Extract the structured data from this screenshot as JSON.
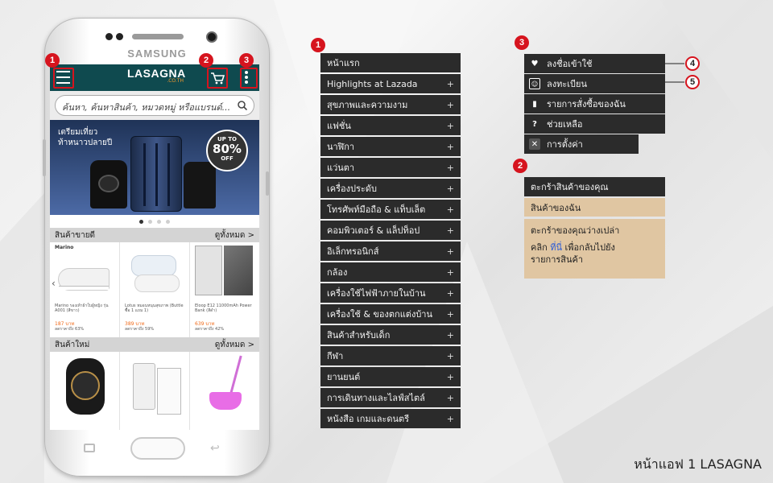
{
  "phone": {
    "brand": "SAMSUNG",
    "app_logo": "LASAGNA",
    "app_logo_sub": ".CO.TH",
    "search_placeholder": "ค้นหา, ค้นหาสินค้า, หมวดหมู่ หรือแบรนด์...",
    "banner": {
      "line1": "เตรียมเที่ยว",
      "line2": "ท้าหนาวปลายปี",
      "badge_top": "UP TO",
      "badge_value": "80%",
      "badge_bottom": "OFF"
    },
    "best_sellers": {
      "title": "สินค้าขายดี",
      "see_all": "ดูทั้งหมด >",
      "products": [
        {
          "brand": "Marino",
          "name": "Marino รองเท้าผ้าใบผู้หญิง รุ่น A001 (สีขาว)",
          "price": "187 บาท",
          "old": "ลดราคาถึง 63%"
        },
        {
          "brand": "Lotus",
          "name": "Lotus หมอนหนุนสุขภาพ (Buttle ซื้อ 1 แถม 1)",
          "price": "389 บาท",
          "old": "ลดราคาถึง 59%"
        },
        {
          "brand": "Eloop",
          "name": "Eloop E12 11000mAh Power Bank (สีดำ)",
          "price": "639 บาท",
          "old": "ลดราคาถึง 42%"
        }
      ]
    },
    "new_items": {
      "title": "สินค้าใหม่",
      "see_all": "ดูทั้งหมด >"
    }
  },
  "markers": [
    "1",
    "2",
    "3",
    "4",
    "5"
  ],
  "menu": {
    "items": [
      {
        "label": "หน้าแรก",
        "expandable": false
      },
      {
        "label": "Highlights at Lazada",
        "expandable": true
      },
      {
        "label": "สุขภาพและความงาม",
        "expandable": true
      },
      {
        "label": "แฟชั่น",
        "expandable": true
      },
      {
        "label": "นาฬิกา",
        "expandable": true
      },
      {
        "label": "แว่นตา",
        "expandable": true
      },
      {
        "label": "เครื่องประดับ",
        "expandable": true
      },
      {
        "label": "โทรศัพท์มือถือ & แท็บเล็ต",
        "expandable": true
      },
      {
        "label": "คอมพิวเตอร์ & แล็ปท็อป",
        "expandable": true
      },
      {
        "label": "อิเล็กทรอนิกส์",
        "expandable": true
      },
      {
        "label": "กล้อง",
        "expandable": true
      },
      {
        "label": "เครื่องใช้ไฟฟ้าภายในบ้าน",
        "expandable": true
      },
      {
        "label": "เครื่องใช้ & ของตกแต่งบ้าน",
        "expandable": true
      },
      {
        "label": "สินค้าสำหรับเด็ก",
        "expandable": true
      },
      {
        "label": "กีฬา",
        "expandable": true
      },
      {
        "label": "ยานยนต์",
        "expandable": true
      },
      {
        "label": "การเดินทางและไลฟ์สไตล์",
        "expandable": true
      },
      {
        "label": "หนังสือ เกมและดนตรี",
        "expandable": true
      }
    ],
    "plus_glyph": "+"
  },
  "user_menu": {
    "items": [
      {
        "label": "ลงชื่อเข้าใช้",
        "icon": "heart-icon"
      },
      {
        "label": "ลงทะเบียน",
        "icon": "register-icon"
      },
      {
        "label": "รายการสั่งซื้อของฉัน",
        "icon": "orders-icon"
      },
      {
        "label": "ช่วยเหลือ",
        "icon": "help-icon"
      },
      {
        "label": "การตั้งค่า",
        "icon": "settings-icon"
      }
    ]
  },
  "cart": {
    "title": "ตะกร้าสินค้าของคุณ",
    "subtitle": "สินค้าของฉัน",
    "empty_text": "ตะกร้าของคุณว่างเปล่า",
    "hint_prefix": "คลิก",
    "hint_link": "ที่นี่",
    "hint_suffix": "เพื่อกลับไปยัง",
    "hint_line2": "รายการสินค้า"
  },
  "caption": "หน้าแอฟ 1 LASAGNA",
  "colors": {
    "appbar": "#0f4a4f",
    "menu_bg": "#2b2b2b",
    "cart_panel": "#e0c6a2",
    "marker": "#d6141e",
    "price": "#f06a1a"
  }
}
